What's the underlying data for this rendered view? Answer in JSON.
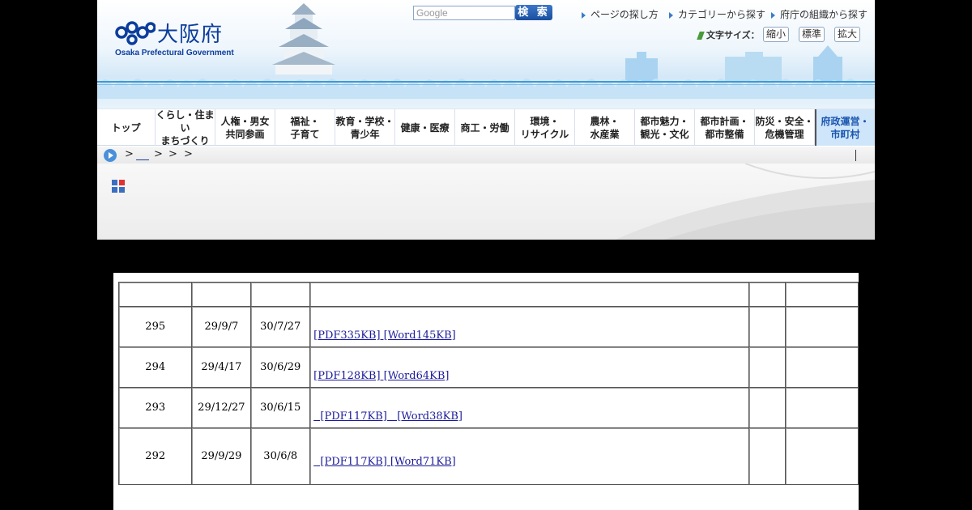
{
  "header": {
    "logo_title": "大阪府",
    "logo_subtitle": "Osaka Prefectural Government",
    "search_placeholder": "Google",
    "search_button": "検 索",
    "links": [
      "ページの探し方",
      "カテゴリーから探す",
      "府庁の組織から探す"
    ],
    "font_size_label": "文字サイズ：",
    "font_size_buttons": [
      "縮小",
      "標準",
      "拡大"
    ]
  },
  "nav": {
    "items": [
      "トップ",
      "くらし・住まい\nまちづくり",
      "人権・男女\n共同参画",
      "福祉・\n子育て",
      "教育・学校・\n青少年",
      "健康・医療",
      "商工・労働",
      "環境・\nリサイクル",
      "農林・\n水産業",
      "都市魅力・\n観光・文化",
      "都市計画・\n都市整備",
      "防災・安全・\n危機管理",
      "府政運営・\n市町村"
    ]
  },
  "breadcrumb": {
    "separators": [
      ">",
      ">",
      ">",
      ">"
    ]
  },
  "table": {
    "rows": [
      {
        "no": "295",
        "date1": "29/9/7",
        "date2": "30/7/27",
        "files": " [PDF335KB] [Word145KB]"
      },
      {
        "no": "294",
        "date1": "29/4/17",
        "date2": "30/6/29",
        "files": " [PDF128KB] [Word64KB]"
      },
      {
        "no": "293",
        "date1": "29/12/27",
        "date2": "30/6/15",
        "files": "  [PDF117KB]   [Word38KB]"
      },
      {
        "no": "292",
        "date1": "29/9/29",
        "date2": "30/6/8",
        "files": "  [PDF117KB] [Word71KB]"
      }
    ]
  },
  "colors": {
    "brand_blue": "#0c3d9c",
    "nav_active_bg": "#cfe6fa",
    "link": "#1a1a99"
  }
}
